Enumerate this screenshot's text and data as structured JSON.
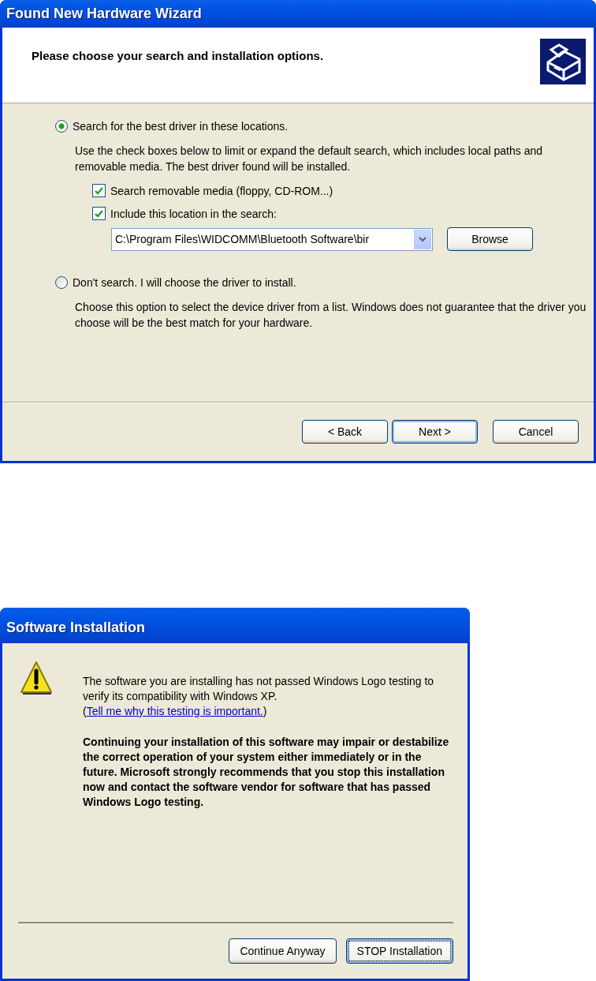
{
  "wizard": {
    "title": "Found New Hardware Wizard",
    "heading": "Please choose your search and installation options.",
    "options": [
      {
        "label": "Search for the best driver in these locations.",
        "selected": true,
        "description": "Use the check boxes below to limit or expand the default search, which includes local paths and removable media. The best driver found will be installed.",
        "checkboxes": [
          {
            "label": "Search removable media (floppy, CD-ROM...)",
            "checked": true
          },
          {
            "label": "Include this location in the search:",
            "checked": true
          }
        ],
        "location": {
          "value": "C:\\Program Files\\WIDCOMM\\Bluetooth Software\\bir",
          "button": "Browse"
        }
      },
      {
        "label": "Don't search. I will choose the driver to install.",
        "selected": false,
        "description": "Choose this option to select the device driver from a list.  Windows does not guarantee that the driver you choose will be the best match for your hardware."
      }
    ],
    "buttons": [
      {
        "label": "< Back",
        "default": false
      },
      {
        "label": "Next >",
        "default": true
      },
      {
        "label": "Cancel",
        "default": false
      }
    ]
  },
  "dialog": {
    "title": "Software Installation",
    "message_before": "The software you are installing has not passed Windows Logo testing to verify its compatibility with Windows XP. (",
    "link": "Tell me why this testing is important.",
    "message_after": ")",
    "warning": "Continuing your installation of this software may impair or destabilize the correct operation of your system either immediately or in the future. Microsoft strongly recommends that you stop this installation now and contact the software vendor for software that has passed Windows Logo testing.",
    "buttons": [
      {
        "label": "Continue Anyway",
        "default": false
      },
      {
        "label": "STOP Installation",
        "default": true
      }
    ]
  }
}
